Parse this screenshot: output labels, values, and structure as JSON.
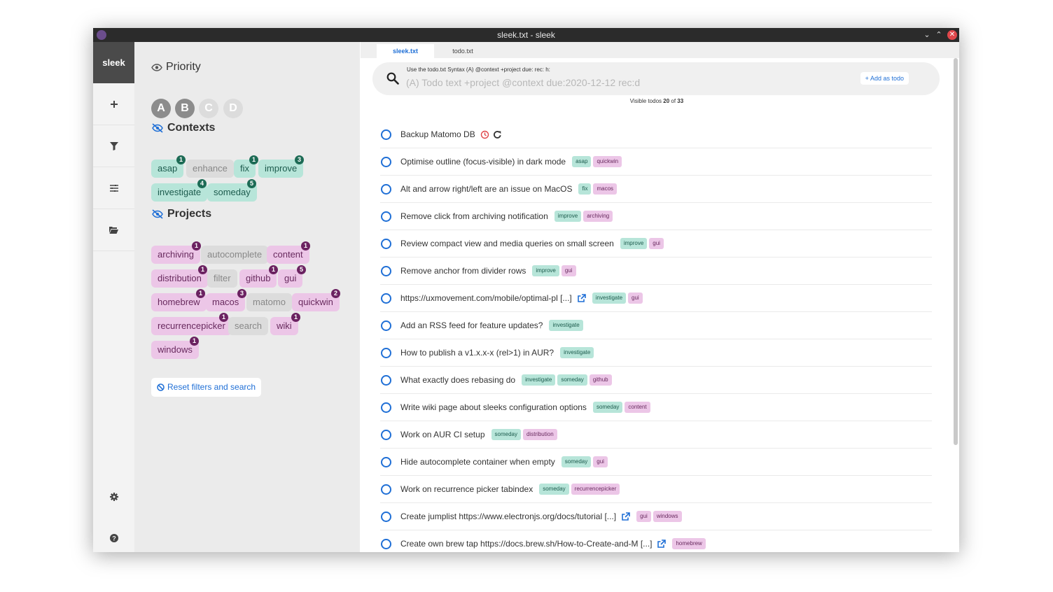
{
  "window": {
    "title": "sleek.txt - sleek"
  },
  "nav": {
    "logo": "sleek",
    "items": [
      {
        "icon": "plus-icon"
      },
      {
        "icon": "filter-icon"
      },
      {
        "icon": "sliders-icon"
      },
      {
        "icon": "folder-open-icon"
      }
    ],
    "bottom_items": [
      {
        "icon": "gear-icon"
      },
      {
        "icon": "question-circle-icon"
      }
    ]
  },
  "drawer": {
    "priority": {
      "title": "Priority",
      "items": [
        {
          "label": "A",
          "active": true
        },
        {
          "label": "B",
          "active": true
        },
        {
          "label": "C",
          "active": false
        },
        {
          "label": "D",
          "active": false
        }
      ]
    },
    "contexts": {
      "title": "Contexts",
      "items": [
        {
          "label": "asap",
          "count": "1",
          "active": true
        },
        {
          "label": "enhance",
          "count": "",
          "active": false
        },
        {
          "label": "fix",
          "count": "1",
          "active": true
        },
        {
          "label": "improve",
          "count": "3",
          "active": true
        },
        {
          "label": "investigate",
          "count": "4",
          "active": true
        },
        {
          "label": "someday",
          "count": "5",
          "active": true
        }
      ]
    },
    "projects": {
      "title": "Projects",
      "items": [
        {
          "label": "archiving",
          "count": "1",
          "active": true
        },
        {
          "label": "autocomplete",
          "count": "",
          "active": false
        },
        {
          "label": "content",
          "count": "1",
          "active": true
        },
        {
          "label": "distribution",
          "count": "1",
          "active": true
        },
        {
          "label": "filter",
          "count": "",
          "active": false
        },
        {
          "label": "github",
          "count": "1",
          "active": true
        },
        {
          "label": "gui",
          "count": "5",
          "active": true
        },
        {
          "label": "homebrew",
          "count": "1",
          "active": true
        },
        {
          "label": "macos",
          "count": "3",
          "active": true
        },
        {
          "label": "matomo",
          "count": "",
          "active": false
        },
        {
          "label": "quickwin",
          "count": "2",
          "active": true
        },
        {
          "label": "recurrencepicker",
          "count": "1",
          "active": true
        },
        {
          "label": "search",
          "count": "",
          "active": false
        },
        {
          "label": "wiki",
          "count": "1",
          "active": true
        },
        {
          "label": "windows",
          "count": "1",
          "active": true
        }
      ]
    },
    "reset_label": "Reset filters and search"
  },
  "tabs": [
    {
      "label": "sleek.txt",
      "active": true
    },
    {
      "label": "todo.txt",
      "active": false
    }
  ],
  "search": {
    "hint": "Use the todo.txt Syntax (A) @context +project due: rec: h:",
    "placeholder": "(A) Todo text +project @context due:2020-12-12 rec:d",
    "add_label": "Add as todo"
  },
  "visible": {
    "prefix": "Visible todos",
    "count": "20",
    "sep": "of",
    "total": "33"
  },
  "todos": [
    {
      "text": "Backup Matomo DB",
      "icons": [
        "clock-icon",
        "refresh-icon"
      ],
      "contexts": [],
      "projects": []
    },
    {
      "text": "Optimise outline (focus-visible) in dark mode",
      "icons": [],
      "contexts": [
        "asap"
      ],
      "projects": [
        "quickwin"
      ]
    },
    {
      "text": "Alt and arrow right/left are an issue on MacOS",
      "icons": [],
      "contexts": [
        "fix"
      ],
      "projects": [
        "macos"
      ]
    },
    {
      "text": "Remove click from archiving notification",
      "icons": [],
      "contexts": [
        "improve"
      ],
      "projects": [
        "archiving"
      ]
    },
    {
      "text": "Review compact view and media queries on small screen",
      "icons": [],
      "contexts": [
        "improve"
      ],
      "projects": [
        "gui"
      ]
    },
    {
      "text": "Remove anchor from divider rows",
      "icons": [],
      "contexts": [
        "improve"
      ],
      "projects": [
        "gui"
      ]
    },
    {
      "text": "https://uxmovement.com/mobile/optimal-pl [...]",
      "icons": [
        "external-link-icon"
      ],
      "contexts": [
        "investigate"
      ],
      "projects": [
        "gui"
      ]
    },
    {
      "text": "Add an RSS feed for feature updates?",
      "icons": [],
      "contexts": [
        "investigate"
      ],
      "projects": []
    },
    {
      "text": "How to publish a v1.x.x-x (rel>1) in AUR?",
      "icons": [],
      "contexts": [
        "investigate"
      ],
      "projects": []
    },
    {
      "text": "What exactly does rebasing do",
      "icons": [],
      "contexts": [
        "investigate",
        "someday"
      ],
      "projects": [
        "github"
      ]
    },
    {
      "text": "Write wiki page about sleeks configuration options",
      "icons": [],
      "contexts": [
        "someday"
      ],
      "projects": [
        "content"
      ]
    },
    {
      "text": "Work on AUR CI setup",
      "icons": [],
      "contexts": [
        "someday"
      ],
      "projects": [
        "distribution"
      ]
    },
    {
      "text": "Hide autocomplete container when empty",
      "icons": [],
      "contexts": [
        "someday"
      ],
      "projects": [
        "gui"
      ]
    },
    {
      "text": "Work on recurrence picker tabindex",
      "icons": [],
      "contexts": [
        "someday"
      ],
      "projects": [
        "recurrencepicker"
      ]
    },
    {
      "text": "Create jumplist https://www.electronjs.org/docs/tutorial [...]",
      "icons": [
        "external-link-icon"
      ],
      "contexts": [],
      "projects": [
        "gui",
        "windows"
      ]
    },
    {
      "text": "Create own brew tap https://docs.brew.sh/How-to-Create-and-M [...]",
      "icons": [
        "external-link-icon"
      ],
      "contexts": [],
      "projects": [
        "homebrew"
      ]
    }
  ],
  "colors": {
    "accent": "#1f6fd6",
    "context_chip": "#b7e5d9",
    "project_chip": "#ecc6e7",
    "context_badge": "#1d6b55",
    "project_badge": "#6b2261",
    "priority_active": "#8c8c8c",
    "priority_inactive": "#dcdcdc",
    "close_button": "#e0474b"
  }
}
